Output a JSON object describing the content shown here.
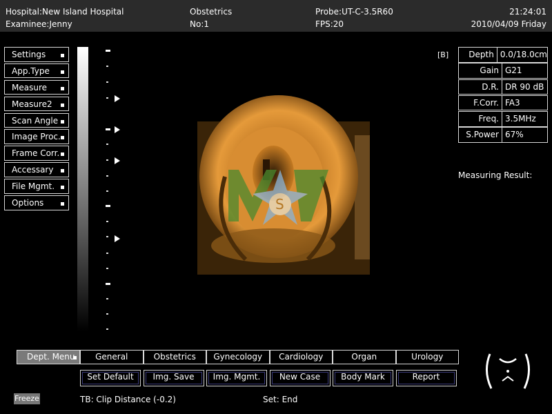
{
  "header": {
    "hospital": "Hospital:New Island Hospital",
    "examinee": "Examinee:Jenny",
    "dept": "Obstetrics",
    "no": "No:1",
    "probe": "Probe:UT-C-3.5R60",
    "fps": "FPS:20",
    "time": "21:24:01",
    "date": "2010/04/09 Friday"
  },
  "menu": {
    "items": [
      {
        "label": "Settings"
      },
      {
        "label": "App.Type"
      },
      {
        "label": "Measure"
      },
      {
        "label": "Measure2"
      },
      {
        "label": "Scan Angle"
      },
      {
        "label": "Image Proc."
      },
      {
        "label": "Frame Corr."
      },
      {
        "label": "Accessary"
      },
      {
        "label": "File Mgmt."
      },
      {
        "label": "Options"
      }
    ]
  },
  "mode_marker": "[B]",
  "params": [
    {
      "key": "Depth",
      "value": "0.0/18.0cm"
    },
    {
      "key": "Gain",
      "value": "G21"
    },
    {
      "key": "D.R.",
      "value": "DR 90 dB"
    },
    {
      "key": "F.Corr.",
      "value": "FA3"
    },
    {
      "key": "Freq.",
      "value": "3.5MHz"
    },
    {
      "key": "S.Power",
      "value": "67%"
    }
  ],
  "measuring_result": "Measuring Result:",
  "dept_menu": {
    "active": "Dept. Menu",
    "tabs": [
      "General",
      "Obstetrics",
      "Gynecology",
      "Cardiology",
      "Organ",
      "Urology"
    ]
  },
  "actions": [
    "Set Default",
    "Img. Save",
    "Img. Mgmt.",
    "New Case",
    "Body Mark",
    "Report"
  ],
  "freeze": "Freeze",
  "status": {
    "tb": "TB: Clip Distance (-0.2)",
    "set": "Set: End"
  },
  "colors": {
    "accent": "#e8a040",
    "panel_bg": "#2b2b2b",
    "border": "#d9d9d9",
    "active_tab": "#7a7a7a"
  }
}
